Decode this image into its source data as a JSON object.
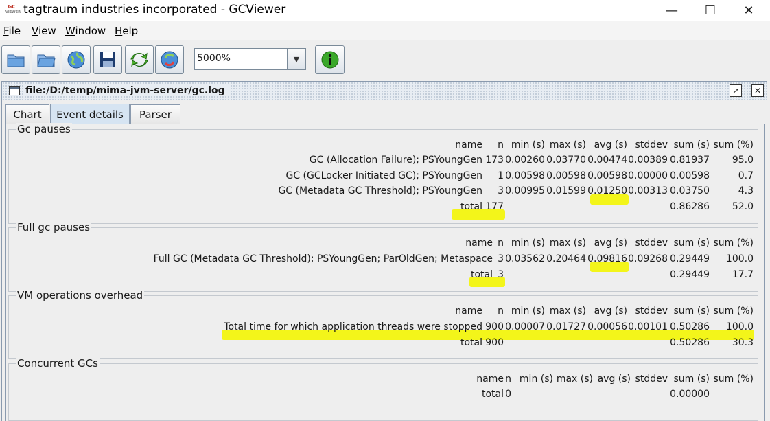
{
  "window": {
    "title": "tagtraum industries incorporated - GCViewer",
    "icon_text_top": "GC",
    "icon_text_bottom": "VIEWER",
    "minimize": "—",
    "maximize": "☐",
    "close": "✕"
  },
  "menu": [
    {
      "key": "F",
      "rest": "ile"
    },
    {
      "key": "V",
      "rest": "iew"
    },
    {
      "key": "W",
      "rest": "indow"
    },
    {
      "key": "H",
      "rest": "elp"
    }
  ],
  "toolbar": {
    "buttons": [
      "open-file-icon",
      "open-folder-icon",
      "open-url-icon",
      "save-icon",
      "refresh-icon",
      "watch-icon"
    ],
    "zoom_value": "5000%",
    "info_icon": "info-icon"
  },
  "internal_frame": {
    "title": "file:/D:/temp/mima-jvm-server/gc.log"
  },
  "tabs": [
    "Chart",
    "Event details",
    "Parser"
  ],
  "active_tab": "Event details",
  "columns": [
    "name",
    "n",
    "min (s)",
    "max (s)",
    "avg (s)",
    "stddev",
    "sum (s)",
    "sum (%)"
  ],
  "sections": [
    {
      "title": "Gc pauses",
      "rows": [
        [
          "GC (Allocation Failure); PSYoungGen",
          "173",
          "0.00260",
          "0.03770",
          "0.00474",
          "0.00389",
          "0.81937",
          "95.0"
        ],
        [
          "GC (GCLocker Initiated GC); PSYoungGen",
          "1",
          "0.00598",
          "0.00598",
          "0.00598",
          "0.00000",
          "0.00598",
          "0.7"
        ],
        [
          "GC (Metadata GC Threshold); PSYoungGen",
          "3",
          "0.00995",
          "0.01599",
          "0.01250",
          "0.00313",
          "0.03750",
          "4.3"
        ]
      ],
      "total": [
        "total",
        "177",
        "",
        "",
        "",
        "",
        "0.86286",
        "52.0"
      ]
    },
    {
      "title": "Full gc pauses",
      "rows": [
        [
          "Full GC (Metadata GC Threshold); PSYoungGen; ParOldGen; Metaspace",
          "3",
          "0.03562",
          "0.20464",
          "0.09816",
          "0.09268",
          "0.29449",
          "100.0"
        ]
      ],
      "total": [
        "total",
        "3",
        "",
        "",
        "",
        "",
        "0.29449",
        "17.7"
      ]
    },
    {
      "title": "VM operations overhead",
      "rows": [
        [
          "Total time for which application threads were stopped",
          "900",
          "0.00007",
          "0.01727",
          "0.00056",
          "0.00101",
          "0.50286",
          "100.0"
        ]
      ],
      "total": [
        "total",
        "900",
        "",
        "",
        "",
        "",
        "0.50286",
        "30.3"
      ]
    },
    {
      "title": "Concurrent GCs",
      "rows": [],
      "total": [
        "total",
        "0",
        "",
        "",
        "",
        "",
        "0.00000",
        ""
      ]
    }
  ],
  "highlight_color": "#f3f51a"
}
